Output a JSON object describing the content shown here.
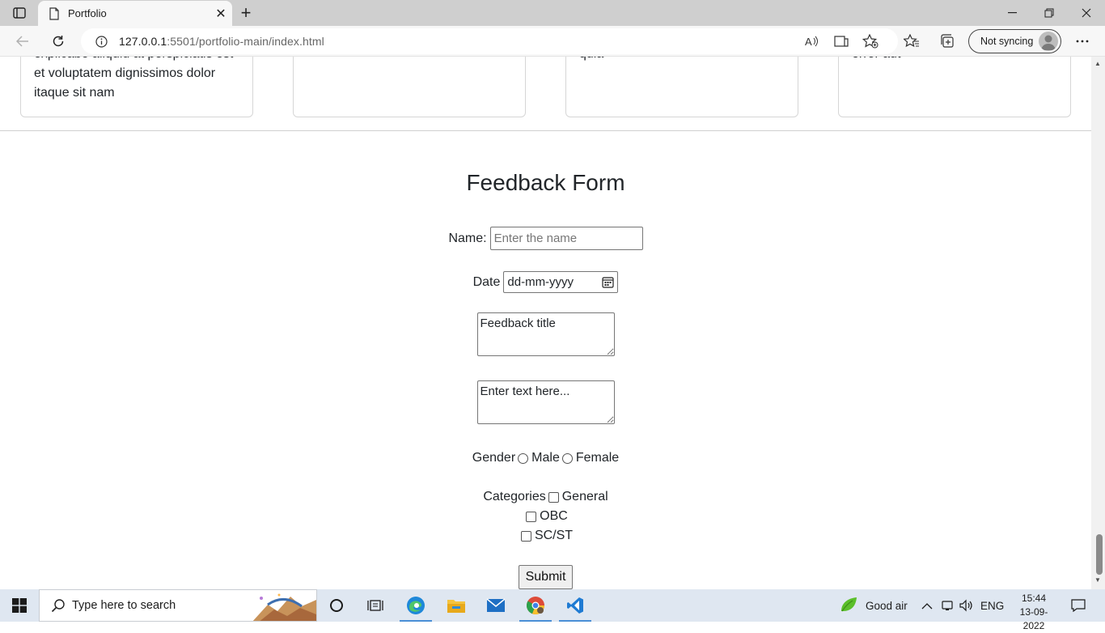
{
  "browser": {
    "tab_title": "Portfolio",
    "url_host": "127.0.0.1",
    "url_path": ":5501/portfolio-main/index.html",
    "sync_label": "Not syncing"
  },
  "cards": [
    {
      "lines": [
        "explicabo aliquid at perspiciatis est",
        "et voluptatem dignissimos dolor",
        "itaque sit nam"
      ]
    },
    {
      "lines": []
    },
    {
      "lines": [
        "quia"
      ]
    },
    {
      "lines": [
        "error aut"
      ]
    }
  ],
  "form": {
    "title": "Feedback Form",
    "name_label": "Name:",
    "name_placeholder": "Enter the name",
    "date_label": "Date",
    "date_value": "dd-mm-yyyy",
    "feedback_title_placeholder": "Feedback title",
    "text_placeholder": "Enter text here...",
    "gender_label": "Gender",
    "gender_options": [
      "Male",
      "Female"
    ],
    "categories_label": "Categories",
    "category_options": [
      "General",
      "OBC",
      "SC/ST"
    ],
    "submit_label": "Submit"
  },
  "taskbar": {
    "search_placeholder": "Type here to search",
    "weather": "Good air",
    "lang": "ENG",
    "time": "15:44",
    "date": "13-09-2022"
  }
}
